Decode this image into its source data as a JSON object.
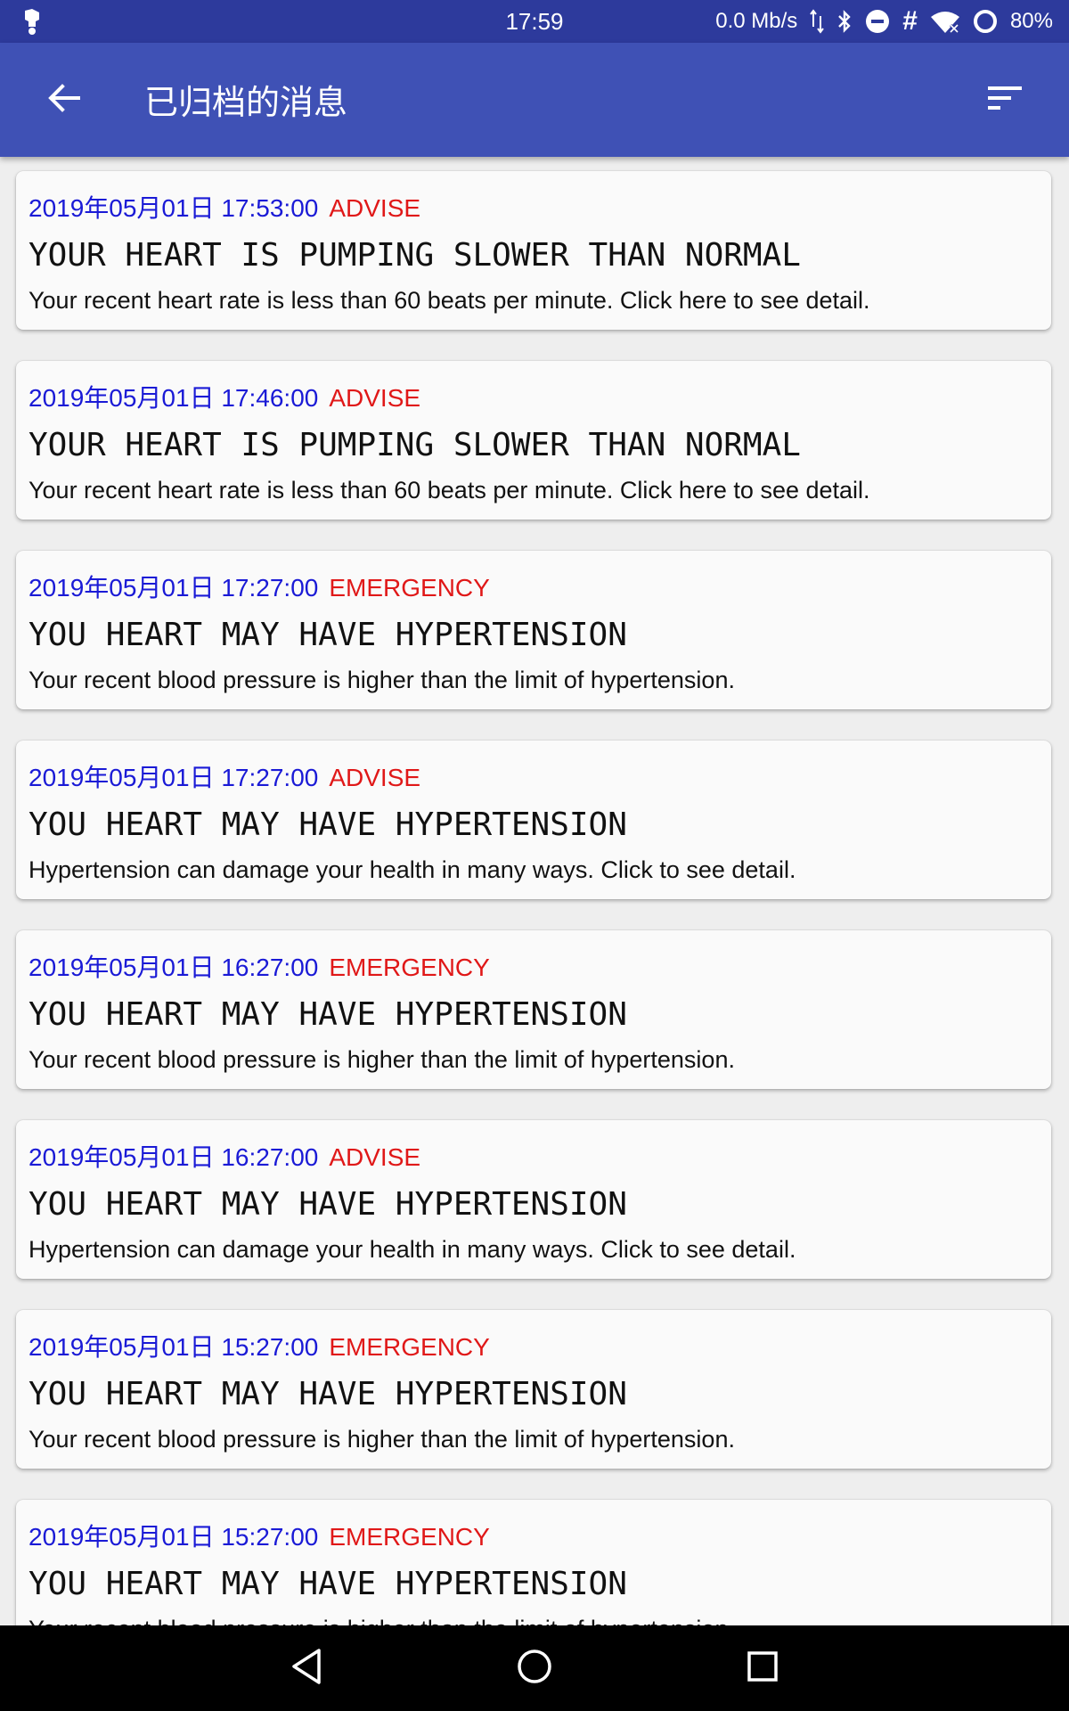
{
  "status_bar": {
    "time": "17:59",
    "net_speed": "0.0 Mb/s",
    "hash": "#",
    "battery": "80%"
  },
  "app_bar": {
    "title": "已归档的消息"
  },
  "colors": {
    "status_bar": "#2d3a9c",
    "app_bar": "#3f51b5",
    "date_text": "#1a1ad6",
    "level_text": "#e01818",
    "card_bg": "#fafafa",
    "list_bg": "#eeeeee"
  },
  "messages": [
    {
      "date": "2019年05月01日 17:53:00",
      "level": "ADVISE",
      "headline": "YOUR HEART IS PUMPING SLOWER THAN NORMAL",
      "body": "Your recent heart rate is less than 60 beats per minute. Click here to see detail."
    },
    {
      "date": "2019年05月01日 17:46:00",
      "level": "ADVISE",
      "headline": "YOUR HEART IS PUMPING SLOWER THAN NORMAL",
      "body": "Your recent heart rate is less than 60 beats per minute. Click here to see detail."
    },
    {
      "date": "2019年05月01日 17:27:00",
      "level": "EMERGENCY",
      "headline": "YOU HEART MAY HAVE HYPERTENSION",
      "body": "Your recent blood pressure is higher than the limit of hypertension."
    },
    {
      "date": "2019年05月01日 17:27:00",
      "level": "ADVISE",
      "headline": "YOU HEART MAY HAVE HYPERTENSION",
      "body": "Hypertension can damage your health in many ways. Click to see detail."
    },
    {
      "date": "2019年05月01日 16:27:00",
      "level": "EMERGENCY",
      "headline": "YOU HEART MAY HAVE HYPERTENSION",
      "body": "Your recent blood pressure is higher than the limit of hypertension."
    },
    {
      "date": "2019年05月01日 16:27:00",
      "level": "ADVISE",
      "headline": "YOU HEART MAY HAVE HYPERTENSION",
      "body": "Hypertension can damage your health in many ways. Click to see detail."
    },
    {
      "date": "2019年05月01日 15:27:00",
      "level": "EMERGENCY",
      "headline": "YOU HEART MAY HAVE HYPERTENSION",
      "body": "Your recent blood pressure is higher than the limit of hypertension."
    },
    {
      "date": "2019年05月01日 15:27:00",
      "level": "EMERGENCY",
      "headline": "YOU HEART MAY HAVE HYPERTENSION",
      "body": "Your recent blood pressure is higher than the limit of hypertension."
    }
  ],
  "icons": {
    "back": "arrow-back-icon",
    "sort": "sort-icon",
    "nav_back": "triangle-back-icon",
    "nav_home": "circle-home-icon",
    "nav_recents": "square-recents-icon"
  }
}
